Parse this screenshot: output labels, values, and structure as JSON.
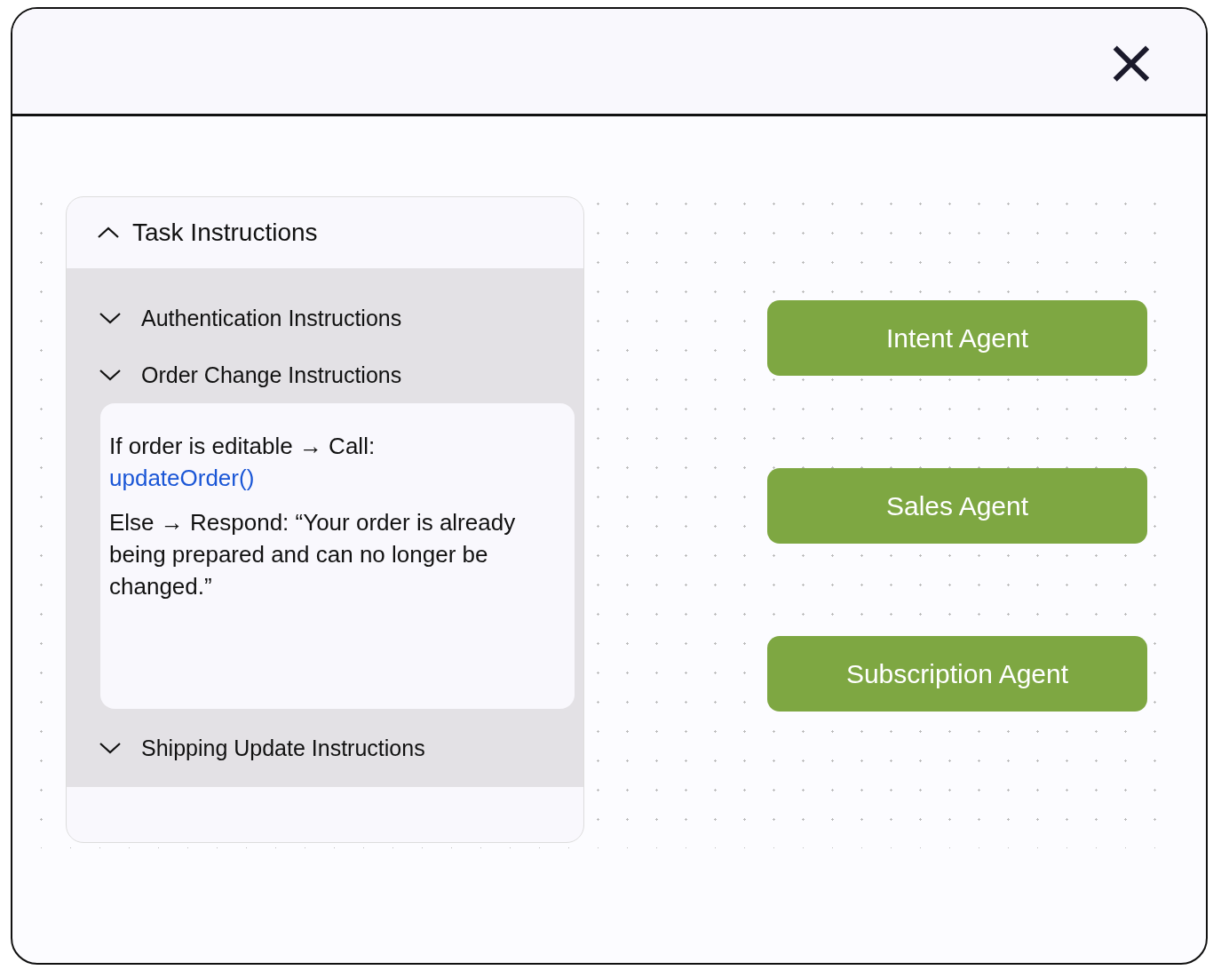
{
  "window": {
    "close": "×"
  },
  "panel": {
    "title": "Task Instructions",
    "expanded": true,
    "sections": [
      {
        "title": "Authentication Instructions"
      },
      {
        "title": "Order Change Instructions",
        "body": [
          {
            "text": "If order is editable → Call:",
            "link": "updateOrder()"
          },
          {
            "text": "Else → Respond: “Your order is already being prepared and can no longer be changed.”"
          }
        ]
      },
      {
        "title": "Shipping Update Instructions"
      }
    ]
  },
  "agents": [
    "Intent Agent",
    "Sales Agent",
    "Subscription Agent"
  ]
}
